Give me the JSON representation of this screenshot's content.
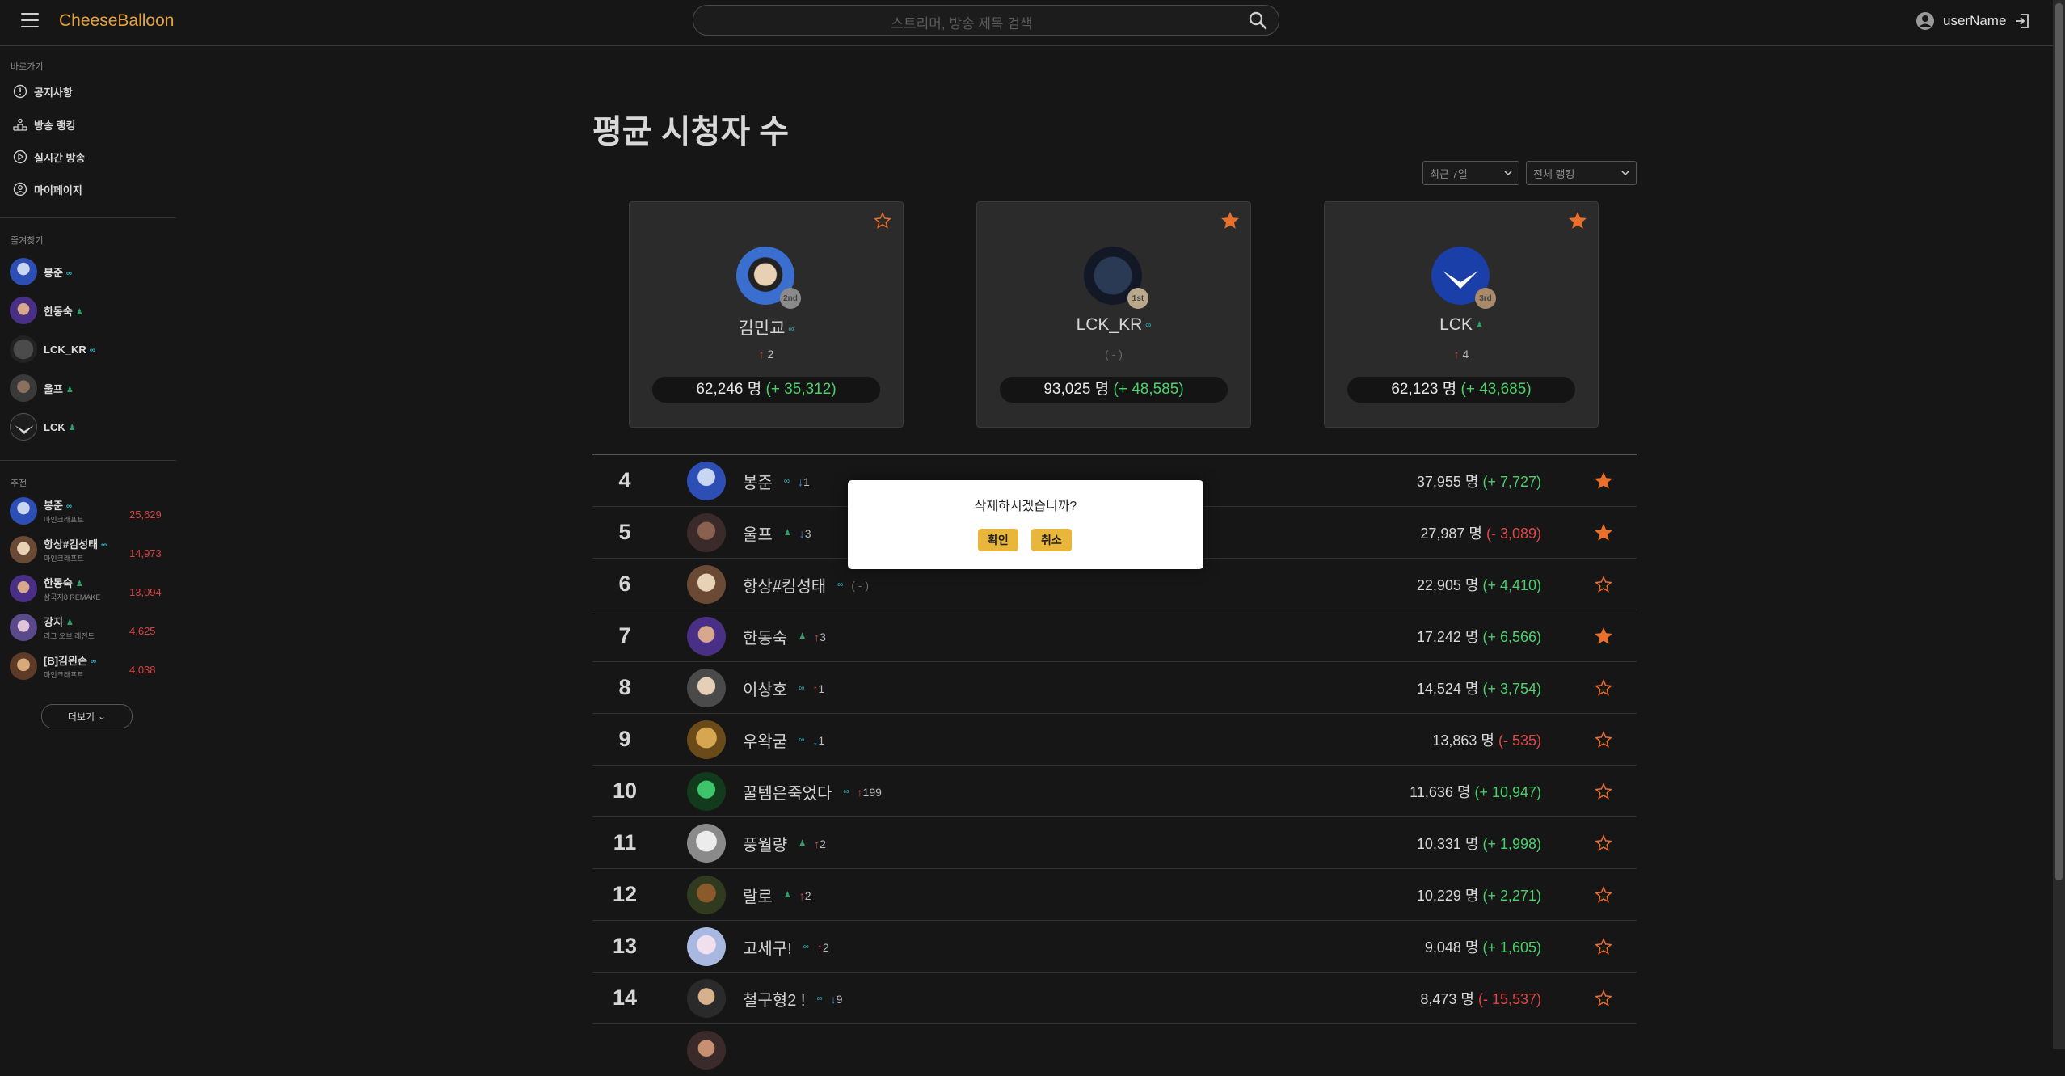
{
  "header": {
    "logo": "CheeseBalloon",
    "search_placeholder": "스트리머, 방송 제목 검색",
    "user_name": "userName"
  },
  "sidebar": {
    "shortcuts_heading": "바로가기",
    "nav": [
      {
        "label": "공지사항",
        "icon": "info-icon"
      },
      {
        "label": "방송 랭킹",
        "icon": "podium-icon"
      },
      {
        "label": "실시간 방송",
        "icon": "play-icon"
      },
      {
        "label": "마이페이지",
        "icon": "user-circle-icon"
      }
    ],
    "favorites_heading": "즐겨찾기",
    "favorites": [
      {
        "name": "봉준",
        "platform": "chz"
      },
      {
        "name": "한동숙",
        "platform": "afreeca"
      },
      {
        "name": "LCK_KR",
        "platform": "chz"
      },
      {
        "name": "울프",
        "platform": "afreeca"
      },
      {
        "name": "LCK",
        "platform": "afreeca"
      }
    ],
    "recommend_heading": "추천",
    "recommend": [
      {
        "name": "봉준",
        "platform": "chz",
        "sub": "마인크래프트",
        "count": "25,629"
      },
      {
        "name": "항상#킴성태",
        "platform": "chz",
        "sub": "마인크래프트",
        "count": "14,973"
      },
      {
        "name": "한동숙",
        "platform": "afreeca",
        "sub": "삼국지8 REMAKE",
        "count": "13,094"
      },
      {
        "name": "강지",
        "platform": "afreeca",
        "sub": "리그 오브 레전드",
        "count": "4,625"
      },
      {
        "name": "[B]김왼손",
        "platform": "chz",
        "sub": "마인크래프트",
        "count": "4,038"
      }
    ],
    "more_label": "더보기"
  },
  "main": {
    "title": "평균 시청자 수",
    "period_select": "최근 7일",
    "platform_select": "전체 랭킹",
    "top3": [
      {
        "name": "김민교",
        "platform": "chz",
        "rank_label": "2nd",
        "change": "2",
        "change_dir": "up",
        "viewers": "62,246 명",
        "delta": "(+ 35,312)",
        "starred": false
      },
      {
        "name": "LCK_KR",
        "platform": "chz",
        "rank_label": "1st",
        "change": "( - )",
        "change_dir": "same",
        "viewers": "93,025 명",
        "delta": "(+ 48,585)",
        "starred": true
      },
      {
        "name": "LCK",
        "platform": "afreeca",
        "rank_label": "3rd",
        "change": "4",
        "change_dir": "up",
        "viewers": "62,123 명",
        "delta": "(+ 43,685)",
        "starred": true
      }
    ],
    "rows": [
      {
        "rank": "4",
        "name": "봉준",
        "platform": "chz",
        "change": "1",
        "dir": "down",
        "viewers": "37,955 명",
        "delta": "(+ 7,727)",
        "delta_dir": "plus",
        "starred": true
      },
      {
        "rank": "5",
        "name": "울프",
        "platform": "afreeca",
        "change": "3",
        "dir": "down",
        "viewers": "27,987 명",
        "delta": "(- 3,089)",
        "delta_dir": "minus",
        "starred": true
      },
      {
        "rank": "6",
        "name": "항상#킴성태",
        "platform": "chz",
        "change": "( - )",
        "dir": "same",
        "viewers": "22,905 명",
        "delta": "(+ 4,410)",
        "delta_dir": "plus",
        "starred": false
      },
      {
        "rank": "7",
        "name": "한동숙",
        "platform": "afreeca",
        "change": "3",
        "dir": "up",
        "viewers": "17,242 명",
        "delta": "(+ 6,566)",
        "delta_dir": "plus",
        "starred": true
      },
      {
        "rank": "8",
        "name": "이상호",
        "platform": "chz",
        "change": "1",
        "dir": "up",
        "viewers": "14,524 명",
        "delta": "(+ 3,754)",
        "delta_dir": "plus",
        "starred": false
      },
      {
        "rank": "9",
        "name": "우왁굳",
        "platform": "chz",
        "change": "1",
        "dir": "down",
        "viewers": "13,863 명",
        "delta": "(- 535)",
        "delta_dir": "minus",
        "starred": false
      },
      {
        "rank": "10",
        "name": "꿀템은죽었다",
        "platform": "chz",
        "change": "199",
        "dir": "up",
        "viewers": "11,636 명",
        "delta": "(+ 10,947)",
        "delta_dir": "plus",
        "starred": false
      },
      {
        "rank": "11",
        "name": "풍월량",
        "platform": "afreeca",
        "change": "2",
        "dir": "up",
        "viewers": "10,331 명",
        "delta": "(+ 1,998)",
        "delta_dir": "plus",
        "starred": false
      },
      {
        "rank": "12",
        "name": "랄로",
        "platform": "afreeca",
        "change": "2",
        "dir": "up",
        "viewers": "10,229 명",
        "delta": "(+ 2,271)",
        "delta_dir": "plus",
        "starred": false
      },
      {
        "rank": "13",
        "name": "고세구!",
        "platform": "chz",
        "change": "2",
        "dir": "up",
        "viewers": "9,048 명",
        "delta": "(+ 1,605)",
        "delta_dir": "plus",
        "starred": false
      },
      {
        "rank": "14",
        "name": "철구형2 !",
        "platform": "chz",
        "change": "9",
        "dir": "down",
        "viewers": "8,473 명",
        "delta": "(- 15,537)",
        "delta_dir": "minus",
        "starred": false
      }
    ]
  },
  "modal": {
    "message": "삭제하시겠습니까?",
    "confirm_label": "확인",
    "cancel_label": "취소"
  },
  "colors": {
    "accent_logo": "#e3a33a",
    "star_filled": "#e8702a",
    "positive": "#4bd16b",
    "negative": "#e04848",
    "rank_down": "#3b8fe0",
    "modal_button": "#e8b63b"
  }
}
